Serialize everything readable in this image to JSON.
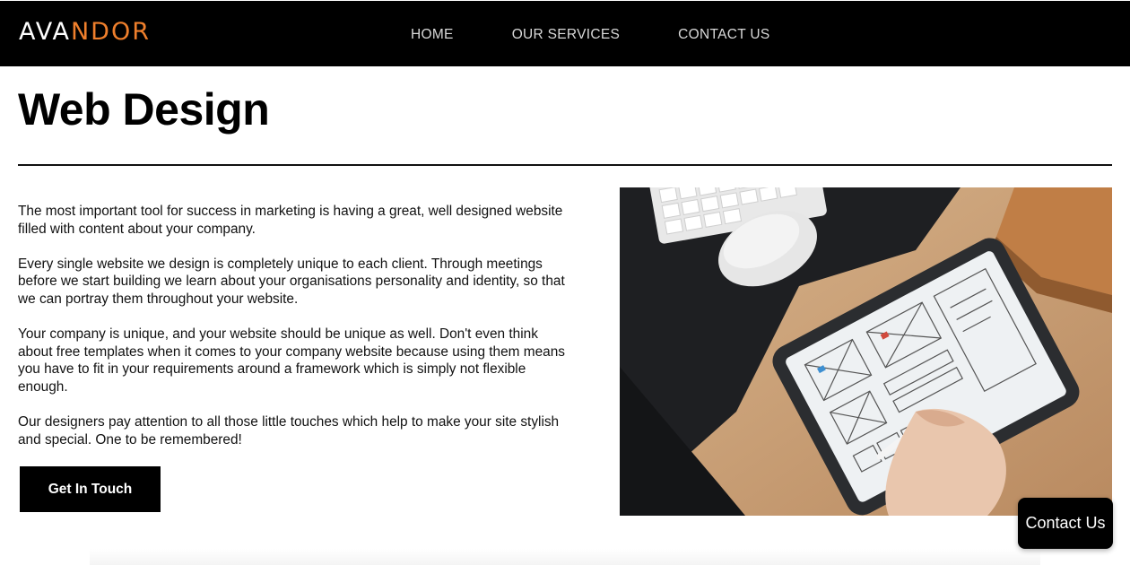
{
  "header": {
    "logo_part1": "AVA",
    "logo_part2": "NDOR",
    "nav": [
      {
        "label": "HOME"
      },
      {
        "label": "OUR SERVICES"
      },
      {
        "label": "CONTACT US"
      }
    ]
  },
  "main": {
    "title": "Web Design",
    "paragraphs": [
      "The most important tool for success in marketing is having a great, well designed website filled with content about your company.",
      "Every single website we design is completely unique to each client. Through meetings before we start building we learn about your organisations personality and identity, so that we can portray them throughout your website.",
      "Your company is unique, and your website should be unique as well. Don't even think about free templates when it comes to your company website because using them means you have to fit in your requirements around a framework which is simply not flexible enough.",
      "Our designers pay attention to all those little touches which help to make your site stylish and special. One to be remembered!"
    ],
    "cta_label": "Get In Touch"
  },
  "floating": {
    "contact_label": "Contact Us"
  },
  "colors": {
    "accent": "#ef7f2c",
    "header_bg": "#000000",
    "button_bg": "#000000"
  }
}
